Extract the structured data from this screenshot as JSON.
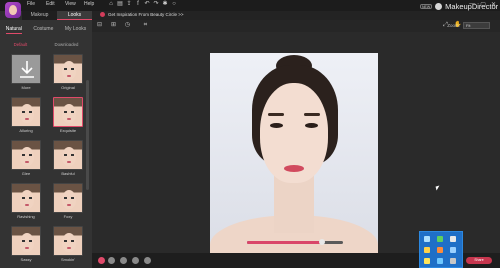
{
  "app": {
    "menu": [
      "File",
      "Edit",
      "View",
      "Help"
    ],
    "badge": "NEW",
    "brand": "MakeupDirector",
    "window_buttons": [
      "—",
      "▢",
      "✕"
    ]
  },
  "mode_tabs": [
    "Makeup",
    "Looks"
  ],
  "promo": {
    "text": "Get Inspiration From Beauty Circle >>"
  },
  "toolbar": {
    "zoom_label": "Zoom:",
    "zoom_value": "Fit"
  },
  "panel": {
    "categories": [
      "Natural",
      "Costume",
      "My Looks"
    ],
    "subtabs": [
      "Default",
      "Downloaded"
    ],
    "looks": [
      {
        "label": "More"
      },
      {
        "label": "Original"
      },
      {
        "label": "Alluring"
      },
      {
        "label": "Exquisite"
      },
      {
        "label": "Glee"
      },
      {
        "label": "Bashful"
      },
      {
        "label": "Ravishing"
      },
      {
        "label": "Foxy"
      },
      {
        "label": "Sassy"
      },
      {
        "label": "Smokin'"
      }
    ]
  },
  "canvas": {
    "slider_level": 0.78
  },
  "status": {
    "share": "Share"
  },
  "colors": {
    "accent": "#e04a6a",
    "brand": "#b04ac9",
    "tray": "#1f6fc7"
  }
}
